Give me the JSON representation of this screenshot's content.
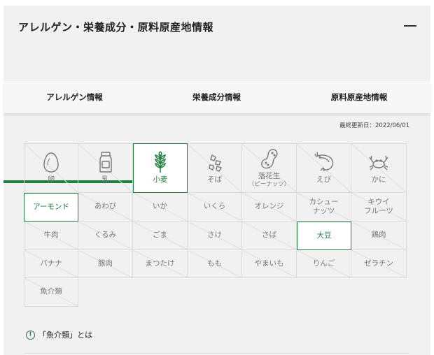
{
  "header": {
    "title": "アレルゲン・栄養成分・原料原産地情報"
  },
  "tabs": [
    {
      "label": "アレルゲン情報",
      "active": true
    },
    {
      "label": "栄養成分情報",
      "active": false
    },
    {
      "label": "原料原産地情報",
      "active": false
    }
  ],
  "updated": "最終更新日：2022/06/01",
  "allergens": {
    "icons_row": [
      {
        "label": "卵",
        "sub": "",
        "icon": "egg-icon",
        "active": false
      },
      {
        "label": "乳",
        "sub": "",
        "icon": "milk-icon",
        "active": false
      },
      {
        "label": "小麦",
        "sub": "",
        "icon": "wheat-icon",
        "active": true
      },
      {
        "label": "そば",
        "sub": "",
        "icon": "buckwheat-icon",
        "active": false
      },
      {
        "label": "落花生",
        "sub": "（ピーナッツ）",
        "icon": "peanut-icon",
        "active": false
      },
      {
        "label": "えび",
        "sub": "",
        "icon": "shrimp-icon",
        "active": false
      },
      {
        "label": "かに",
        "sub": "",
        "icon": "crab-icon",
        "active": false
      }
    ],
    "text_rows": [
      [
        {
          "label": "アーモンド",
          "active": true
        },
        {
          "label": "あわび",
          "active": false
        },
        {
          "label": "いか",
          "active": false
        },
        {
          "label": "いくら",
          "active": false
        },
        {
          "label": "オレンジ",
          "active": false
        },
        {
          "label": "カシュー\nナッツ",
          "active": false
        },
        {
          "label": "キウイ\nフルーツ",
          "active": false
        }
      ],
      [
        {
          "label": "牛肉",
          "active": false
        },
        {
          "label": "くるみ",
          "active": false
        },
        {
          "label": "ごま",
          "active": false
        },
        {
          "label": "さけ",
          "active": false
        },
        {
          "label": "さば",
          "active": false
        },
        {
          "label": "大豆",
          "active": true
        },
        {
          "label": "鶏肉",
          "active": false
        }
      ],
      [
        {
          "label": "バナナ",
          "active": false
        },
        {
          "label": "豚肉",
          "active": false
        },
        {
          "label": "まつたけ",
          "active": false
        },
        {
          "label": "もも",
          "active": false
        },
        {
          "label": "やまいも",
          "active": false
        },
        {
          "label": "りんご",
          "active": false
        },
        {
          "label": "ゼラチン",
          "active": false
        }
      ],
      [
        {
          "label": "魚介類",
          "active": false
        }
      ]
    ]
  },
  "note": {
    "icon_text": "!",
    "label": "「魚介類」とは"
  },
  "colors": {
    "accent": "#1e7f3e",
    "inactive_text": "#777777",
    "panel_bg": "#f1f1f1"
  }
}
